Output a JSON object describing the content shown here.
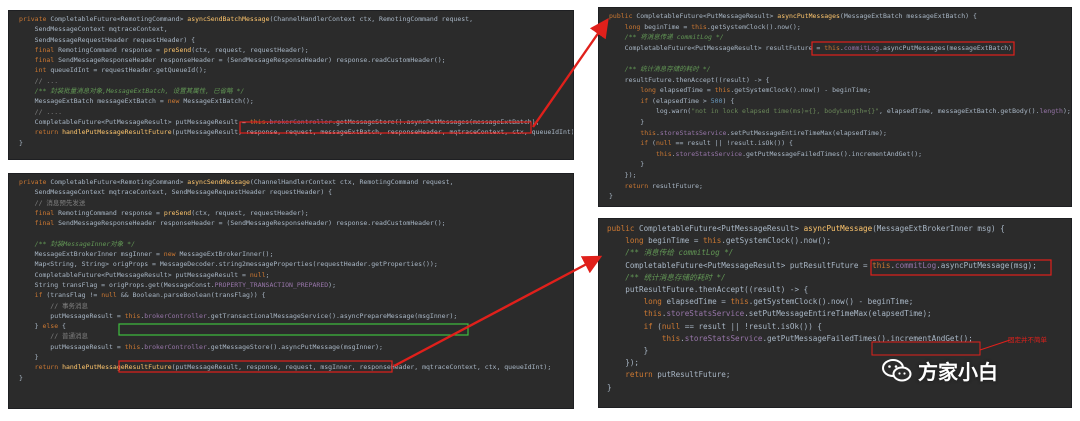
{
  "panels": [
    {
      "id": "p1",
      "title": "asyncSendBatchMessage",
      "lines": [
        "private CompletableFuture<RemotingCommand> asyncSendBatchMessage(ChannelHandlerContext ctx, RemotingCommand request,",
        "    SendMessageContext mqtraceContext,",
        "    SendMessageRequestHeader requestHeader) {",
        "    final RemotingCommand response = preSend(ctx, request, requestHeader);",
        "    final SendMessageResponseHeader responseHeader = (SendMessageResponseHeader) response.readCustomHeader();",
        "    int queueIdInt = requestHeader.getQueueId();",
        "    // ...",
        "    /** 封装批量消息对象,MessageExtBatch, 设置其属性, 已省略 */",
        "    MessageExtBatch messageExtBatch = new MessageExtBatch();",
        "    // ....",
        "    CompletableFuture<PutMessageResult> putMessageResult = this.brokerController.getMessageStore().asyncPutMessages(messageExtBatch);",
        "    return handlePutMessageResultFuture(putMessageResult, response, request, messageExtBatch, responseHeader, mqtraceContext, ctx, queueIdInt);",
        "}"
      ]
    },
    {
      "id": "p2",
      "title": "asyncSendMessage",
      "lines": [
        "private CompletableFuture<RemotingCommand> asyncSendMessage(ChannelHandlerContext ctx, RemotingCommand request,",
        "    SendMessageContext mqtraceContext, SendMessageRequestHeader requestHeader) {",
        "    // 消息预先发送",
        "    final RemotingCommand response = preSend(ctx, request, requestHeader);",
        "    final SendMessageResponseHeader responseHeader = (SendMessageResponseHeader) response.readCustomHeader();",
        "",
        "    /** 封装MessageInner对象 */",
        "    MessageExtBrokerInner msgInner = new MessageExtBrokerInner();",
        "    Map<String, String> origProps = MessageDecoder.string2messageProperties(requestHeader.getProperties());",
        "    CompletableFuture<PutMessageResult> putMessageResult = null;",
        "    String transFlag = origProps.get(MessageConst.PROPERTY_TRANSACTION_PREPARED);",
        "    if (transFlag != null && Boolean.parseBoolean(transFlag)) {",
        "        // 事务消息",
        "        putMessageResult = this.brokerController.getTransactionalMessageService().asyncPrepareMessage(msgInner);",
        "    } else {",
        "        // 普通消息",
        "        putMessageResult = this.brokerController.getMessageStore().asyncPutMessage(msgInner);",
        "    }",
        "    return handlePutMessageResultFuture(putMessageResult, response, request, msgInner, responseHeader, mqtraceContext, ctx, queueIdInt);",
        "}"
      ]
    },
    {
      "id": "p3",
      "title": "asyncPutMessages",
      "lines": [
        "public CompletableFuture<PutMessageResult> asyncPutMessages(MessageExtBatch messageExtBatch) {",
        "    long beginTime = this.getSystemClock().now();",
        "    /** 将消息传递 commitLog */",
        "    CompletableFuture<PutMessageResult> resultFuture = this.commitLog.asyncPutMessages(messageExtBatch);",
        "",
        "    /** 统计消息存储的耗时 */",
        "    resultFuture.thenAccept((result) -> {",
        "        long elapsedTime = this.getSystemClock().now() - beginTime;",
        "        if (elapsedTime > 500) {",
        "            log.warn(\"not in lock elapsed time(ms)={}, bodyLength={}\", elapsedTime, messageExtBatch.getBody().length);",
        "        }",
        "        this.storeStatsService.setPutMessageEntireTimeMax(elapsedTime);",
        "        if (null == result || !result.isOk()) {",
        "            this.storeStatsService.getPutMessageFailedTimes().incrementAndGet();",
        "        }",
        "    });",
        "    return resultFuture;",
        "}"
      ]
    },
    {
      "id": "p4",
      "title": "asyncPutMessage",
      "lines": [
        "public CompletableFuture<PutMessageResult> asyncPutMessage(MessageExtBrokerInner msg) {",
        "    long beginTime = this.getSystemClock().now();",
        "    /** 消息传给 commitLog */",
        "    CompletableFuture<PutMessageResult> putResultFuture = this.commitLog.asyncPutMessage(msg);",
        "    /** 统计消息存储的耗时 */",
        "    putResultFuture.thenAccept((result) -> {",
        "        long elapsedTime = this.getSystemClock().now() - beginTime;",
        "        this.storeStatsService.setPutMessageEntireTimeMax(elapsedTime);",
        "        if (null == result || !result.isOk()) {",
        "            this.storeStatsService.getPutMessageFailedTimes().incrementAndGet();",
        "        }",
        "    });",
        "    return putResultFuture;",
        "}"
      ]
    }
  ],
  "watermark": {
    "text": "方家小白",
    "icon": "wechat-icon"
  },
  "annotation": "固定并不简单",
  "colors": {
    "background": "#2b2b2b",
    "keyword": "#cc7832",
    "method": "#ffc66d",
    "comment": "#808080",
    "doc_comment": "#629755",
    "field": "#9876aa",
    "string": "#6a8759",
    "number": "#6897bb",
    "highlight_red": "#e0201b",
    "highlight_green": "#3fbf3f"
  }
}
